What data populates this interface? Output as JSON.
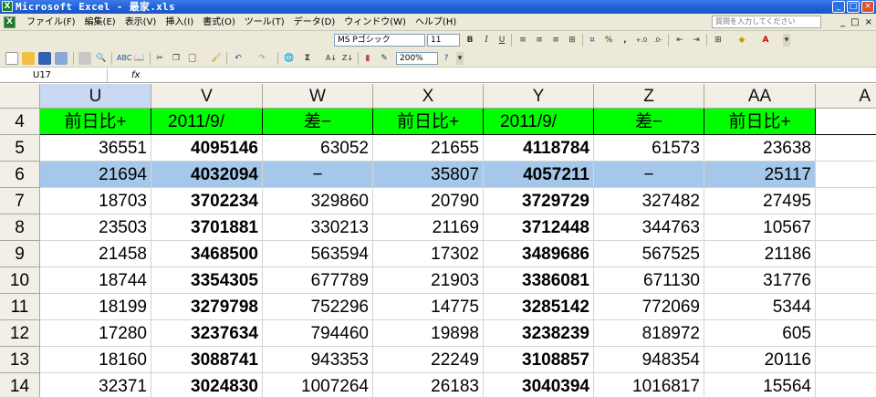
{
  "window": {
    "title": "Microsoft Excel - 最家.xls",
    "min": "_",
    "max": "□",
    "close": "×"
  },
  "menubar": {
    "items": [
      "ファイル(F)",
      "編集(E)",
      "表示(V)",
      "挿入(I)",
      "書式(O)",
      "ツール(T)",
      "データ(D)",
      "ウィンドウ(W)",
      "ヘルプ(H)"
    ],
    "help_placeholder": "質問を入力してください",
    "mdi": [
      "_",
      "□",
      "×"
    ]
  },
  "toolbar": {
    "font_name": "MS Pゴシック",
    "font_size": "11",
    "bold": "B",
    "italic": "I",
    "underline": "U",
    "percent": "%",
    "comma": ",",
    "sum": "Σ",
    "zoom": "200%"
  },
  "formula_bar": {
    "name_box": "U17",
    "fx": "fx",
    "content": ""
  },
  "colors": {
    "header_fill": "#00ff00",
    "highlight_row": "#a5c8ea",
    "active_column_header": "#c9d8f3"
  },
  "grid": {
    "columns": [
      "U",
      "V",
      "W",
      "X",
      "Y",
      "Z",
      "AA",
      "A"
    ],
    "rows": [
      {
        "num": "4",
        "cells": [
          "前日比+",
          "2011/9/",
          "差−",
          "前日比+",
          "2011/9/",
          "差−",
          "前日比+"
        ]
      },
      {
        "num": "5",
        "cells": [
          "36551",
          "4095146",
          "63052",
          "21655",
          "4118784",
          "61573",
          "23638"
        ]
      },
      {
        "num": "6",
        "cells": [
          "21694",
          "4032094",
          "−",
          "35807",
          "4057211",
          "−",
          "25117"
        ]
      },
      {
        "num": "7",
        "cells": [
          "18703",
          "3702234",
          "329860",
          "20790",
          "3729729",
          "327482",
          "27495"
        ]
      },
      {
        "num": "8",
        "cells": [
          "23503",
          "3701881",
          "330213",
          "21169",
          "3712448",
          "344763",
          "10567"
        ]
      },
      {
        "num": "9",
        "cells": [
          "21458",
          "3468500",
          "563594",
          "17302",
          "3489686",
          "567525",
          "21186"
        ]
      },
      {
        "num": "10",
        "cells": [
          "18744",
          "3354305",
          "677789",
          "21903",
          "3386081",
          "671130",
          "31776"
        ]
      },
      {
        "num": "11",
        "cells": [
          "18199",
          "3279798",
          "752296",
          "14775",
          "3285142",
          "772069",
          "5344"
        ]
      },
      {
        "num": "12",
        "cells": [
          "17280",
          "3237634",
          "794460",
          "19898",
          "3238239",
          "818972",
          "605"
        ]
      },
      {
        "num": "13",
        "cells": [
          "18160",
          "3088741",
          "943353",
          "22249",
          "3108857",
          "948354",
          "20116"
        ]
      },
      {
        "num": "14",
        "cells": [
          "32371",
          "3024830",
          "1007264",
          "26183",
          "3040394",
          "1016817",
          "15564"
        ]
      }
    ]
  }
}
